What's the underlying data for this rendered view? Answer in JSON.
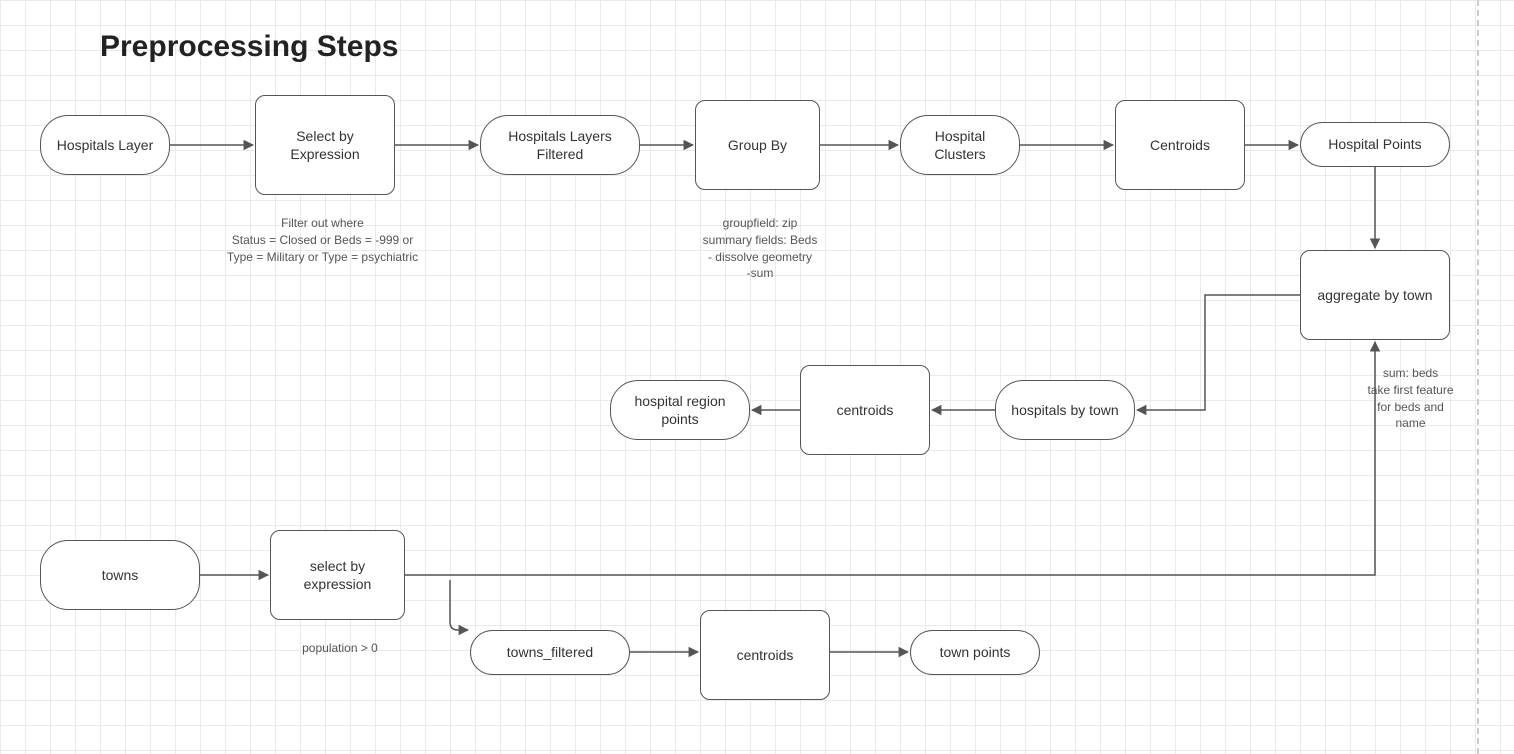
{
  "title": "Preprocessing Steps",
  "nodes": {
    "hospitals_layer": "Hospitals\nLayer",
    "select_by_expression_1": "Select by\nExpression",
    "hospitals_layers_filtered": "Hospitals\nLayers Filtered",
    "group_by": "Group By",
    "hospital_clusters": "Hospital\nClusters",
    "centroids_1": "Centroids",
    "hospital_points": "Hospital Points",
    "aggregate_by_town": "aggregate by\ntown",
    "hospitals_by_town": "hospitals by\ntown",
    "centroids_2": "centroids",
    "hospital_region_points": "hospital\nregion points",
    "towns": "towns",
    "select_by_expression_2": "select by\nexpression",
    "towns_filtered": "towns_filtered",
    "centroids_3": "centroids",
    "town_points": "town points"
  },
  "notes": {
    "filter_note": "Filter out where\nStatus = Closed or Beds = -999 or\nType = Military or Type = psychiatric",
    "groupby_note": "groupfield: zip\nsummary fields: Beds\n- dissolve geometry\n-sum",
    "aggregate_note": "sum: beds\ntake first feature\nfor beds and\nname",
    "population_note": "population > 0"
  }
}
